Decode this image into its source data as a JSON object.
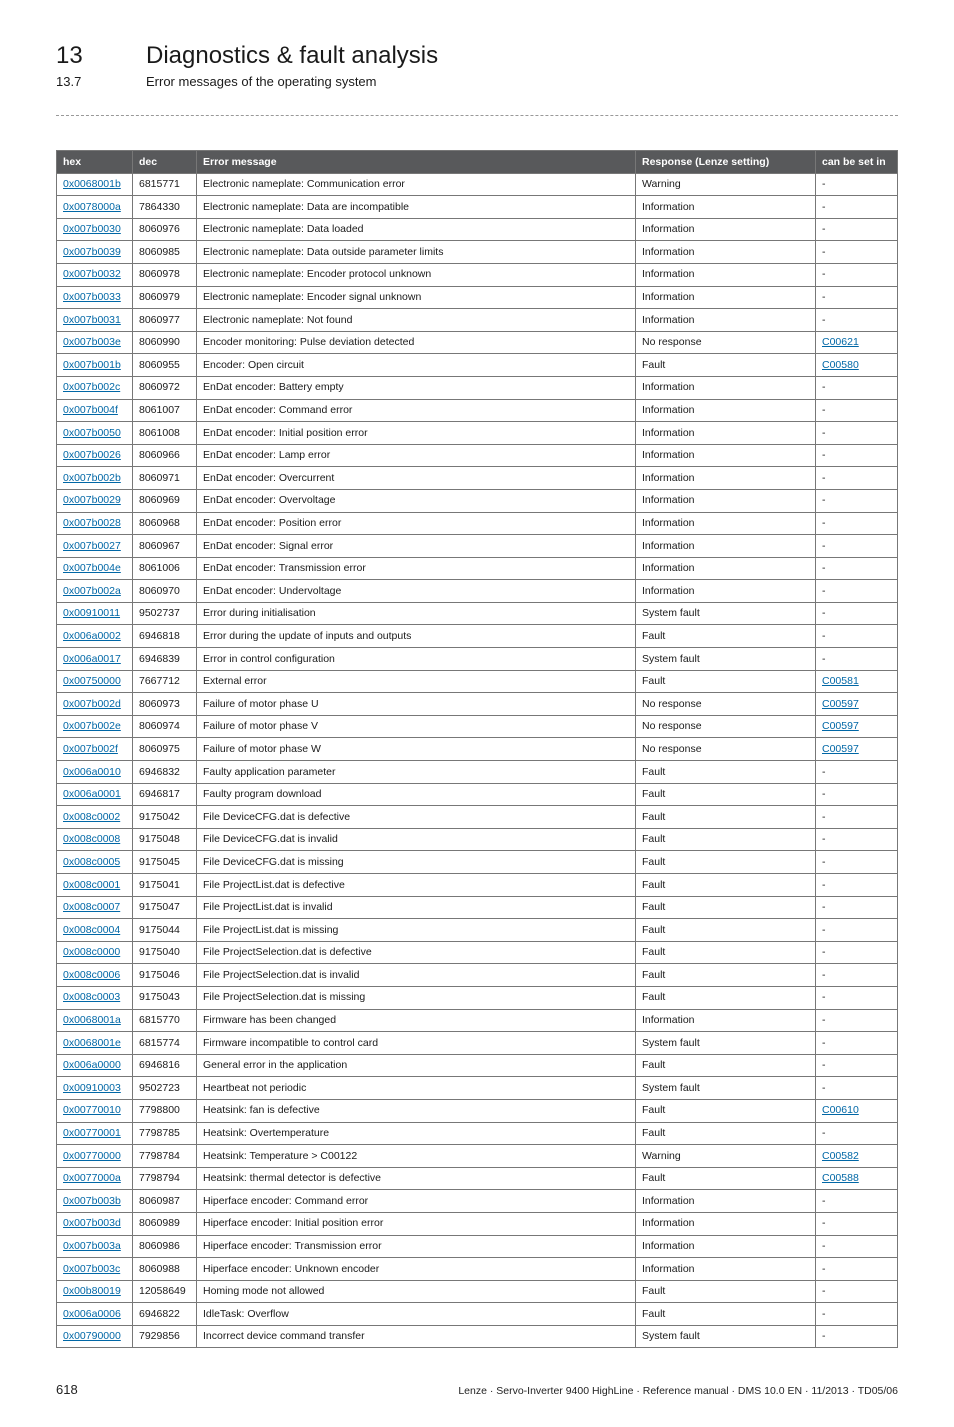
{
  "chapter": {
    "number": "13",
    "title": "Diagnostics & fault analysis"
  },
  "section": {
    "number": "13.7",
    "title": "Error messages of the operating system"
  },
  "table": {
    "headers": {
      "hex": "hex",
      "dec": "dec",
      "msg": "Error message",
      "resp": "Response (Lenze setting)",
      "set": "can be set in"
    },
    "rows": [
      {
        "hex": "0x0068001b",
        "dec": "6815771",
        "msg": "Electronic nameplate: Communication error",
        "resp": "Warning",
        "set": "-"
      },
      {
        "hex": "0x0078000a",
        "dec": "7864330",
        "msg": "Electronic nameplate: Data are incompatible",
        "resp": "Information",
        "set": "-"
      },
      {
        "hex": "0x007b0030",
        "dec": "8060976",
        "msg": "Electronic nameplate: Data loaded",
        "resp": "Information",
        "set": "-"
      },
      {
        "hex": "0x007b0039",
        "dec": "8060985",
        "msg": "Electronic nameplate: Data outside parameter limits",
        "resp": "Information",
        "set": "-"
      },
      {
        "hex": "0x007b0032",
        "dec": "8060978",
        "msg": "Electronic nameplate: Encoder protocol unknown",
        "resp": "Information",
        "set": "-"
      },
      {
        "hex": "0x007b0033",
        "dec": "8060979",
        "msg": "Electronic nameplate: Encoder signal unknown",
        "resp": "Information",
        "set": "-"
      },
      {
        "hex": "0x007b0031",
        "dec": "8060977",
        "msg": "Electronic nameplate: Not found",
        "resp": "Information",
        "set": "-"
      },
      {
        "hex": "0x007b003e",
        "dec": "8060990",
        "msg": "Encoder monitoring: Pulse deviation detected",
        "resp": "No response",
        "set": "C00621",
        "setlink": true
      },
      {
        "hex": "0x007b001b",
        "dec": "8060955",
        "msg": "Encoder: Open circuit",
        "resp": "Fault",
        "set": "C00580",
        "setlink": true
      },
      {
        "hex": "0x007b002c",
        "dec": "8060972",
        "msg": "EnDat encoder: Battery empty",
        "resp": "Information",
        "set": "-"
      },
      {
        "hex": "0x007b004f",
        "dec": "8061007",
        "msg": "EnDat encoder: Command error",
        "resp": "Information",
        "set": "-"
      },
      {
        "hex": "0x007b0050",
        "dec": "8061008",
        "msg": "EnDat encoder: Initial position error",
        "resp": "Information",
        "set": "-"
      },
      {
        "hex": "0x007b0026",
        "dec": "8060966",
        "msg": "EnDat encoder: Lamp error",
        "resp": "Information",
        "set": "-"
      },
      {
        "hex": "0x007b002b",
        "dec": "8060971",
        "msg": "EnDat encoder: Overcurrent",
        "resp": "Information",
        "set": "-"
      },
      {
        "hex": "0x007b0029",
        "dec": "8060969",
        "msg": "EnDat encoder: Overvoltage",
        "resp": "Information",
        "set": "-"
      },
      {
        "hex": "0x007b0028",
        "dec": "8060968",
        "msg": "EnDat encoder: Position error",
        "resp": "Information",
        "set": "-"
      },
      {
        "hex": "0x007b0027",
        "dec": "8060967",
        "msg": "EnDat encoder: Signal error",
        "resp": "Information",
        "set": "-"
      },
      {
        "hex": "0x007b004e",
        "dec": "8061006",
        "msg": "EnDat encoder: Transmission error",
        "resp": "Information",
        "set": "-"
      },
      {
        "hex": "0x007b002a",
        "dec": "8060970",
        "msg": "EnDat encoder: Undervoltage",
        "resp": "Information",
        "set": "-"
      },
      {
        "hex": "0x00910011",
        "dec": "9502737",
        "msg": "Error during initialisation",
        "resp": "System fault",
        "set": "-"
      },
      {
        "hex": "0x006a0002",
        "dec": "6946818",
        "msg": "Error during the update of inputs and outputs",
        "resp": "Fault",
        "set": "-"
      },
      {
        "hex": "0x006a0017",
        "dec": "6946839",
        "msg": "Error in control configuration",
        "resp": "System fault",
        "set": "-"
      },
      {
        "hex": "0x00750000",
        "dec": "7667712",
        "msg": "External error",
        "resp": "Fault",
        "set": "C00581",
        "setlink": true
      },
      {
        "hex": "0x007b002d",
        "dec": "8060973",
        "msg": "Failure of motor phase U",
        "resp": "No response",
        "set": "C00597",
        "setlink": true
      },
      {
        "hex": "0x007b002e",
        "dec": "8060974",
        "msg": "Failure of motor phase V",
        "resp": "No response",
        "set": "C00597",
        "setlink": true
      },
      {
        "hex": "0x007b002f",
        "dec": "8060975",
        "msg": "Failure of motor phase W",
        "resp": "No response",
        "set": "C00597",
        "setlink": true
      },
      {
        "hex": "0x006a0010",
        "dec": "6946832",
        "msg": "Faulty application parameter",
        "resp": "Fault",
        "set": "-"
      },
      {
        "hex": "0x006a0001",
        "dec": "6946817",
        "msg": "Faulty program download",
        "resp": "Fault",
        "set": "-"
      },
      {
        "hex": "0x008c0002",
        "dec": "9175042",
        "msg": "File DeviceCFG.dat is defective",
        "resp": "Fault",
        "set": "-"
      },
      {
        "hex": "0x008c0008",
        "dec": "9175048",
        "msg": "File DeviceCFG.dat is invalid",
        "resp": "Fault",
        "set": "-"
      },
      {
        "hex": "0x008c0005",
        "dec": "9175045",
        "msg": "File DeviceCFG.dat is missing",
        "resp": "Fault",
        "set": "-"
      },
      {
        "hex": "0x008c0001",
        "dec": "9175041",
        "msg": "File ProjectList.dat is defective",
        "resp": "Fault",
        "set": "-"
      },
      {
        "hex": "0x008c0007",
        "dec": "9175047",
        "msg": "File ProjectList.dat is invalid",
        "resp": "Fault",
        "set": "-"
      },
      {
        "hex": "0x008c0004",
        "dec": "9175044",
        "msg": "File ProjectList.dat is missing",
        "resp": "Fault",
        "set": "-"
      },
      {
        "hex": "0x008c0000",
        "dec": "9175040",
        "msg": "File ProjectSelection.dat is defective",
        "resp": "Fault",
        "set": "-"
      },
      {
        "hex": "0x008c0006",
        "dec": "9175046",
        "msg": "File ProjectSelection.dat is invalid",
        "resp": "Fault",
        "set": "-"
      },
      {
        "hex": "0x008c0003",
        "dec": "9175043",
        "msg": "File ProjectSelection.dat is missing",
        "resp": "Fault",
        "set": "-"
      },
      {
        "hex": "0x0068001a",
        "dec": "6815770",
        "msg": "Firmware has been changed",
        "resp": "Information",
        "set": "-"
      },
      {
        "hex": "0x0068001e",
        "dec": "6815774",
        "msg": "Firmware incompatible to control card",
        "resp": "System fault",
        "set": "-"
      },
      {
        "hex": "0x006a0000",
        "dec": "6946816",
        "msg": "General error in the application",
        "resp": "Fault",
        "set": "-"
      },
      {
        "hex": "0x00910003",
        "dec": "9502723",
        "msg": "Heartbeat not periodic",
        "resp": "System fault",
        "set": "-"
      },
      {
        "hex": "0x00770010",
        "dec": "7798800",
        "msg": "Heatsink: fan is defective",
        "resp": "Fault",
        "set": "C00610",
        "setlink": true
      },
      {
        "hex": "0x00770001",
        "dec": "7798785",
        "msg": "Heatsink: Overtemperature",
        "resp": "Fault",
        "set": "-"
      },
      {
        "hex": "0x00770000",
        "dec": "7798784",
        "msg": "Heatsink: Temperature > C00122",
        "resp": "Warning",
        "set": "C00582",
        "setlink": true
      },
      {
        "hex": "0x0077000a",
        "dec": "7798794",
        "msg": "Heatsink: thermal detector is defective",
        "resp": "Fault",
        "set": "C00588",
        "setlink": true
      },
      {
        "hex": "0x007b003b",
        "dec": "8060987",
        "msg": "Hiperface encoder: Command error",
        "resp": "Information",
        "set": "-"
      },
      {
        "hex": "0x007b003d",
        "dec": "8060989",
        "msg": "Hiperface encoder: Initial position error",
        "resp": "Information",
        "set": "-"
      },
      {
        "hex": "0x007b003a",
        "dec": "8060986",
        "msg": "Hiperface encoder: Transmission error",
        "resp": "Information",
        "set": "-"
      },
      {
        "hex": "0x007b003c",
        "dec": "8060988",
        "msg": "Hiperface encoder: Unknown encoder",
        "resp": "Information",
        "set": "-"
      },
      {
        "hex": "0x00b80019",
        "dec": "12058649",
        "msg": "Homing mode not allowed",
        "resp": "Fault",
        "set": "-"
      },
      {
        "hex": "0x006a0006",
        "dec": "6946822",
        "msg": "IdleTask: Overflow",
        "resp": "Fault",
        "set": "-"
      },
      {
        "hex": "0x00790000",
        "dec": "7929856",
        "msg": "Incorrect device command transfer",
        "resp": "System fault",
        "set": "-"
      }
    ]
  },
  "footer": {
    "page": "618",
    "docref": "Lenze · Servo-Inverter 9400 HighLine · Reference manual · DMS 10.0 EN · 11/2013 · TD05/06"
  }
}
